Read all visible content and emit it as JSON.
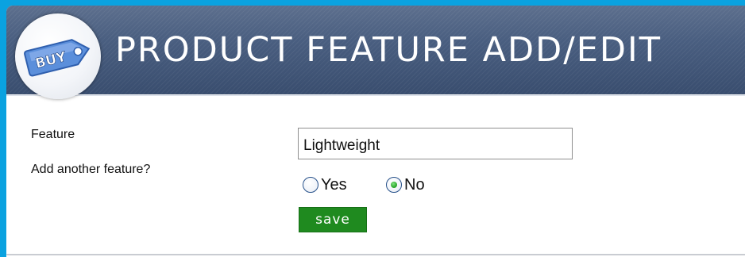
{
  "header": {
    "logo_text": "BUY",
    "title": "PRODUCT FEATURE ADD/EDIT"
  },
  "form": {
    "feature_label": "Feature",
    "feature_value": "Lightweight",
    "another_label": "Add another feature?",
    "option_yes": "Yes",
    "option_no": "No",
    "selected_option": "No",
    "save_label": "save"
  },
  "colors": {
    "page_background": "#0aa2e0",
    "header_background": "#3e5478",
    "save_button": "#1f8a1f",
    "tag_fill": "#5b8fdb"
  },
  "icons": {
    "logo": "buy-tag-icon",
    "radio_yes": "radio-unchecked-icon",
    "radio_no": "radio-checked-icon"
  }
}
